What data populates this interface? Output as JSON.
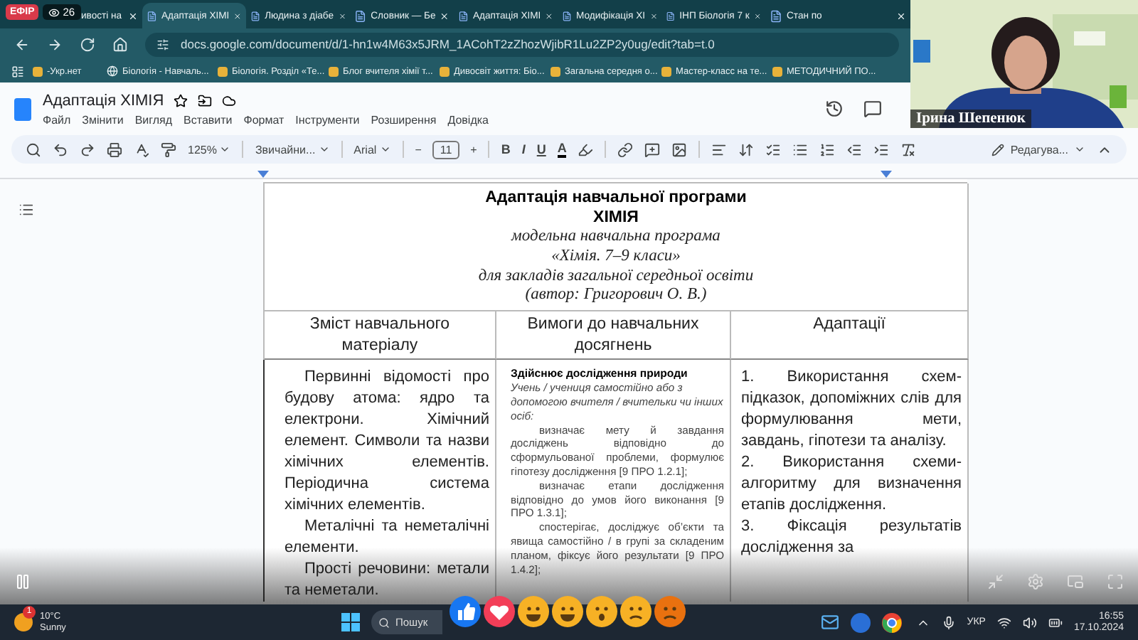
{
  "stream": {
    "live_badge": "ЕФІР",
    "viewers": "26"
  },
  "tabs": [
    {
      "title": "ивості на",
      "selected": false
    },
    {
      "title": "Адаптація ХІМІ",
      "selected": true
    },
    {
      "title": "Людина з діабе",
      "selected": false
    },
    {
      "title": "Словник — Бе",
      "selected": false
    },
    {
      "title": "Адаптація ХІМІ",
      "selected": false
    },
    {
      "title": "Модифікація ХІ",
      "selected": false
    },
    {
      "title": "ІНП Біологія 7 к",
      "selected": false
    },
    {
      "title": "Стан по",
      "selected": false
    }
  ],
  "address_bar": {
    "url": "docs.google.com/document/d/1-hn1w4M63x5JRM_1ACohT2zZhozWjibR1Lu2ZP2y0ug/edit?tab=t.0"
  },
  "bookmarks": [
    "-Укр.нет",
    "Біологія - Навчаль...",
    "Біологія. Розділ «Те...",
    "Блог вчителя хімії т...",
    "Дивосвіт життя: Біо...",
    "Загальна середня о...",
    "Мастер-класс на те...",
    "МЕТОДИЧНИЙ ПО..."
  ],
  "document": {
    "title": "Адаптація ХІМІЯ",
    "menu": [
      "Файл",
      "Змінити",
      "Вигляд",
      "Вставити",
      "Формат",
      "Інструменти",
      "Розширення",
      "Довідка"
    ]
  },
  "toolbar": {
    "zoom": "125%",
    "style": "Звичайни...",
    "font": "Arial",
    "decrease": "−",
    "font_size": "11",
    "increase": "+",
    "bold": "B",
    "italic": "I",
    "underline": "U",
    "text_color": "A",
    "mode": "Редагува..."
  },
  "page": {
    "title": "Адаптація навчальної програми",
    "subject": "ХІМІЯ",
    "subtitle_lines": [
      "модельна навчальна програма",
      "«Хімія. 7–9 класи»",
      "для закладів загальної середньої освіти",
      "(автор: Григорович О. В.)"
    ],
    "columns": [
      "Зміст навчального матеріалу",
      "Вимоги до навчальних досягнень",
      "Адаптації"
    ],
    "content": [
      "Первинні відомості про будову атома: ядро та електрони. Хімічний елемент. Символи та назви хімічних елементів. Періодична система хімічних елементів.",
      "Металічні та неметалічні елементи.",
      "Прості речовини: метали та неметали."
    ],
    "requirements": {
      "heading": "Здійснює дослідження природи",
      "intro": "Учень / учениця самостійно або з допомогою вчителя / вчительки чи інших осіб:",
      "items": [
        "визначає мету й завдання досліджень відповідно до сформульованої проблеми, формулює гіпотезу дослідження [9 ПРО 1.2.1];",
        "визначає етапи дослідження відповідно до умов його виконання [9 ПРО 1.3.1];",
        "спостерігає, досліджує об’єкти та явища самостійно / в групі за складеним планом, фіксує його результати [9 ПРО 1.4.2];"
      ]
    },
    "adaptations": [
      "1. Використання схем-підказок, допоміжних слів для формулювання мети, завдань, гіпотези та аналізу.",
      "2. Використання схеми-алгоритму для визначення етапів дослідження.",
      "3. Фіксація результатів дослідження за"
    ]
  },
  "video_call": {
    "participant": "Ірина Шепенюк"
  },
  "reactions": [
    {
      "kind": "like"
    },
    {
      "kind": "heart"
    },
    {
      "kind": "hug"
    },
    {
      "kind": "laugh"
    },
    {
      "kind": "wow"
    },
    {
      "kind": "sad"
    },
    {
      "kind": "angry"
    }
  ],
  "taskbar": {
    "notification_count": "1",
    "temperature": "10°C",
    "weather": "Sunny",
    "search_placeholder": "Пошук",
    "language": "УКР",
    "time": "16:55",
    "date": "17.10.2024"
  }
}
